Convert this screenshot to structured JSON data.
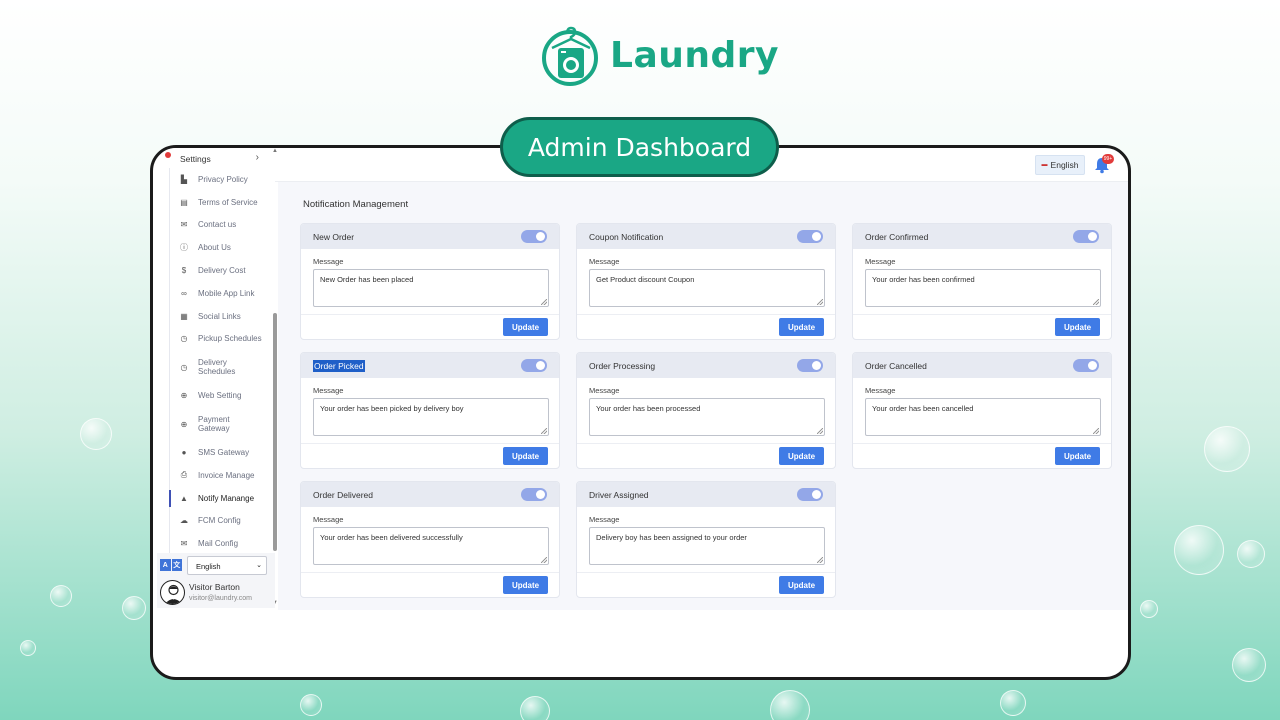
{
  "brand": {
    "name": "Laundry",
    "color": "#1aa785"
  },
  "banner": {
    "label": "Admin Dashboard"
  },
  "sidebar": {
    "settings_label": "Settings",
    "items": [
      {
        "label": "Privacy Policy",
        "icon": "user-shield-icon"
      },
      {
        "label": "Terms of Service",
        "icon": "file-icon"
      },
      {
        "label": "Contact us",
        "icon": "envelope-icon"
      },
      {
        "label": "About Us",
        "icon": "info-icon"
      },
      {
        "label": "Delivery Cost",
        "icon": "dollar-icon"
      },
      {
        "label": "Mobile App Link",
        "icon": "link-icon"
      },
      {
        "label": "Social Links",
        "icon": "share-icon"
      },
      {
        "label": "Pickup Schedules",
        "icon": "clock-icon"
      },
      {
        "label": "Delivery Schedules",
        "icon": "clock-icon"
      },
      {
        "label": "Web Setting",
        "icon": "globe-icon"
      },
      {
        "label": "Payment Gateway",
        "icon": "globe-icon"
      },
      {
        "label": "SMS Gateway",
        "icon": "chat-icon"
      },
      {
        "label": "Invoice Manage",
        "icon": "printer-icon"
      },
      {
        "label": "Notify Manange",
        "icon": "bell-icon"
      },
      {
        "label": "FCM Config",
        "icon": "cloud-icon"
      },
      {
        "label": "Mail Config",
        "icon": "envelope-icon"
      }
    ],
    "active_index": 13,
    "footer": {
      "language": "English",
      "user_name": "Visitor Barton",
      "user_email": "visitor@laundry.com"
    }
  },
  "topbar": {
    "language": "English",
    "notification_count": "99+"
  },
  "main": {
    "title": "Notification Management",
    "message_label": "Message",
    "update_label": "Update",
    "cards": [
      {
        "title": "New Order",
        "message": "New Order has been placed",
        "enabled": true
      },
      {
        "title": "Coupon Notification",
        "message": "Get Product discount Coupon",
        "enabled": true
      },
      {
        "title": "Order Confirmed",
        "message": "Your order has been confirmed",
        "enabled": true
      },
      {
        "title": "Order Picked",
        "message": "Your order has been picked by delivery boy",
        "enabled": true
      },
      {
        "title": "Order Processing",
        "message": "Your order has been processed",
        "enabled": true
      },
      {
        "title": "Order Cancelled",
        "message": "Your order has been cancelled",
        "enabled": true
      },
      {
        "title": "Order Delivered",
        "message": "Your order has been delivered successfully",
        "enabled": true
      },
      {
        "title": "Driver Assigned",
        "message": "Delivery boy has been assigned to your order",
        "enabled": true
      }
    ]
  }
}
